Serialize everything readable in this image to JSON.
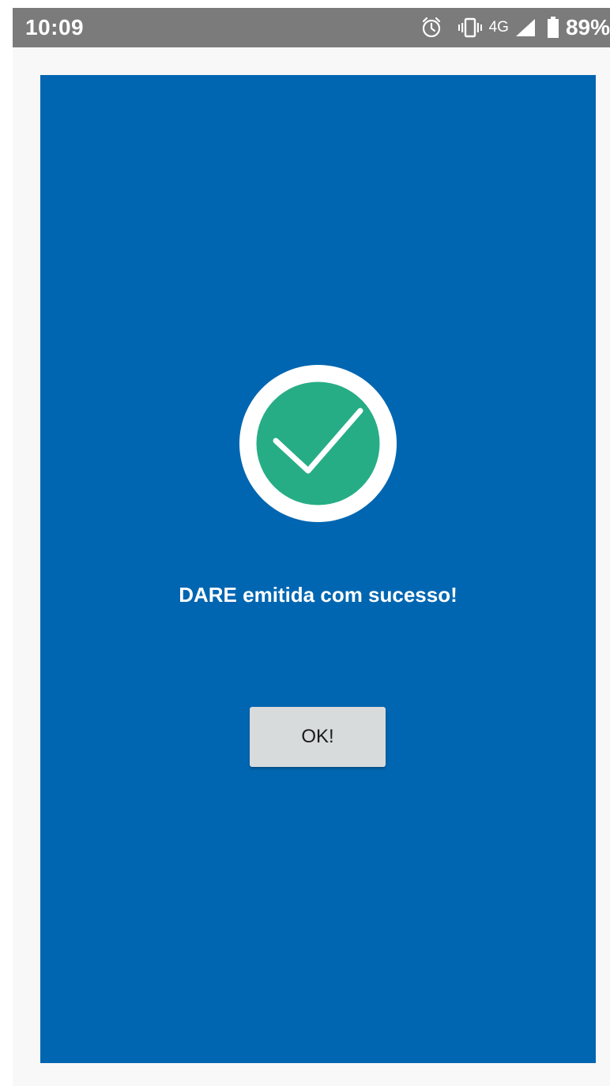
{
  "status_bar": {
    "time": "10:09",
    "network": "4G",
    "battery": "89%",
    "icons": [
      "alarm-icon",
      "vibrate-icon",
      "signal-icon",
      "battery-icon"
    ]
  },
  "dialog": {
    "icon": "checkmark-circle-icon",
    "message": "DARE emitida com sucesso!",
    "button_label": "OK!"
  },
  "colors": {
    "status_bar_bg": "#7b7b7b",
    "dialog_bg": "#0066b1",
    "success_green": "#27ad85",
    "button_bg": "#d8dbdb",
    "app_bg": "#f8f8f8"
  }
}
